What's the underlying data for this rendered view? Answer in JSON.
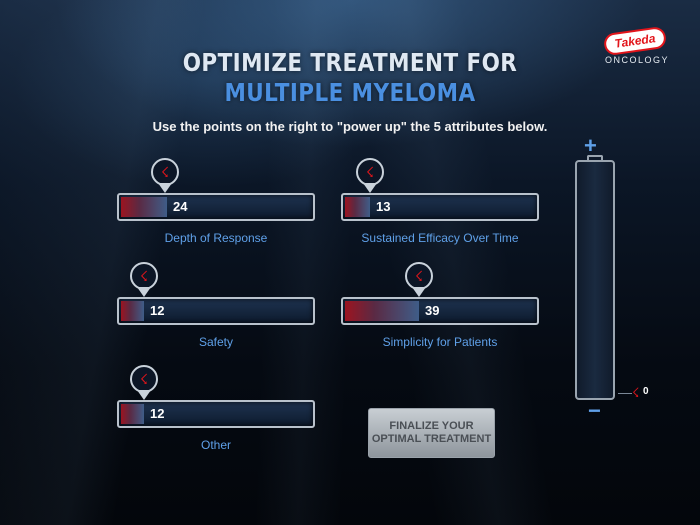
{
  "header": {
    "title_line1": "OPTIMIZE TREATMENT FOR",
    "title_line2": "MULTIPLE MYELOMA",
    "instructions": "Use the points on the right to \"power up\" the 5 attributes below."
  },
  "logo": {
    "brand": "Takeda",
    "subtitle": "ONCOLOGY"
  },
  "attributes": [
    {
      "label": "Depth of Response",
      "value": "24",
      "fill_percent": 24
    },
    {
      "label": "Sustained Efficacy Over Time",
      "value": "13",
      "fill_percent": 13
    },
    {
      "label": "Safety",
      "value": "12",
      "fill_percent": 12
    },
    {
      "label": "Simplicity for Patients",
      "value": "39",
      "fill_percent": 39
    },
    {
      "label": "Other",
      "value": "12",
      "fill_percent": 12
    }
  ],
  "power_icon": "lightning-bolt-icon",
  "finalize_button": {
    "label": "FINALIZE YOUR\nOPTIMAL TREATMENT"
  },
  "points_meter": {
    "plus_label": "+",
    "minus_label": "−",
    "remaining_points": "0"
  },
  "colors": {
    "brand_red": "#e2151b",
    "label_blue": "#5fa0e8",
    "title_blue": "#4a8fe0"
  }
}
